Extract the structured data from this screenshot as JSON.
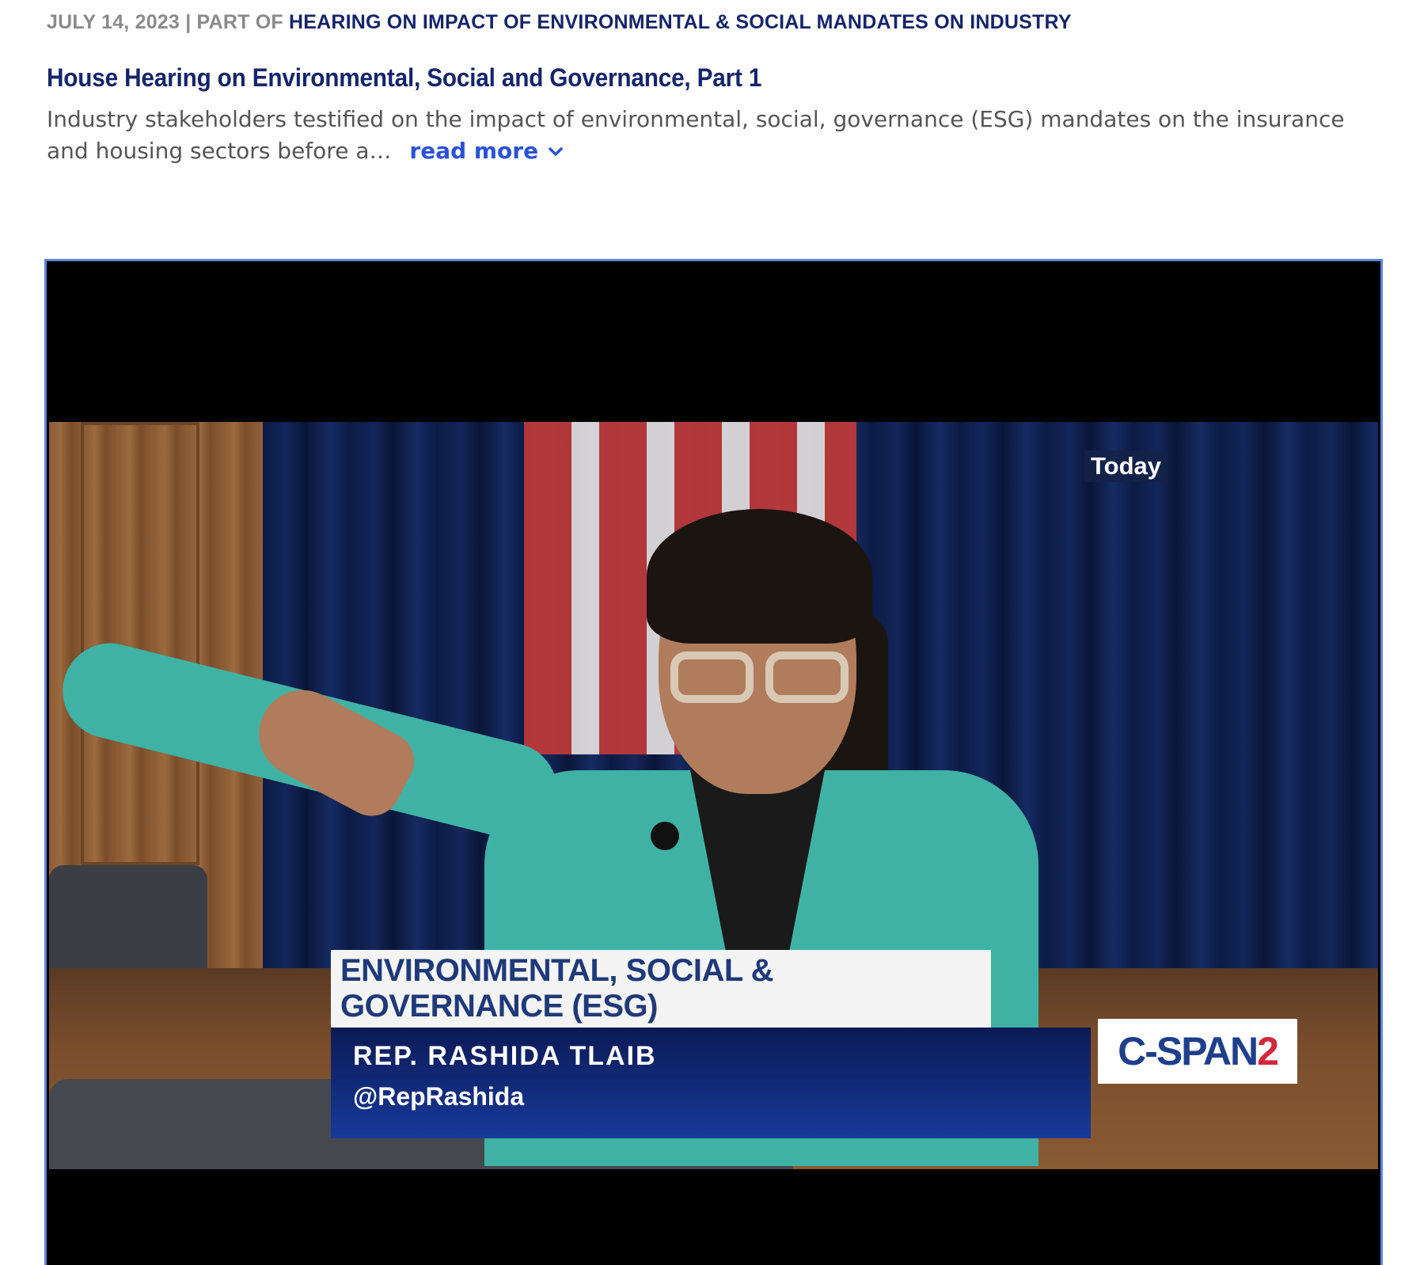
{
  "header": {
    "date": "JULY 14, 2023",
    "separator": "|",
    "part_of_label": "PART OF",
    "series_link": "HEARING ON IMPACT OF ENVIRONMENTAL & SOCIAL MANDATES ON INDUSTRY"
  },
  "program": {
    "title": "House Hearing on Environmental, Social and Governance, Part 1",
    "description_excerpt": "Industry stakeholders testified on the impact of environmental, social, governance (ESG) mandates on the insurance and housing sectors before a…",
    "read_more_label": "read more"
  },
  "video": {
    "bug_text": "Today",
    "lower_third": {
      "topic": "ENVIRONMENTAL, SOCIAL & GOVERNANCE (ESG)",
      "name": "REP. RASHIDA TLAIB",
      "handle": "@RepRashida"
    },
    "network_logo": {
      "main": "C-SPAN",
      "number": "2"
    }
  },
  "colors": {
    "title": "#16246b",
    "meta_gray": "#8a8a8a",
    "link_blue": "#2a52d9",
    "player_border": "#5b86e0",
    "jacket": "#3fb2a5"
  },
  "icons": {
    "read_more": "chevron-down-icon"
  }
}
